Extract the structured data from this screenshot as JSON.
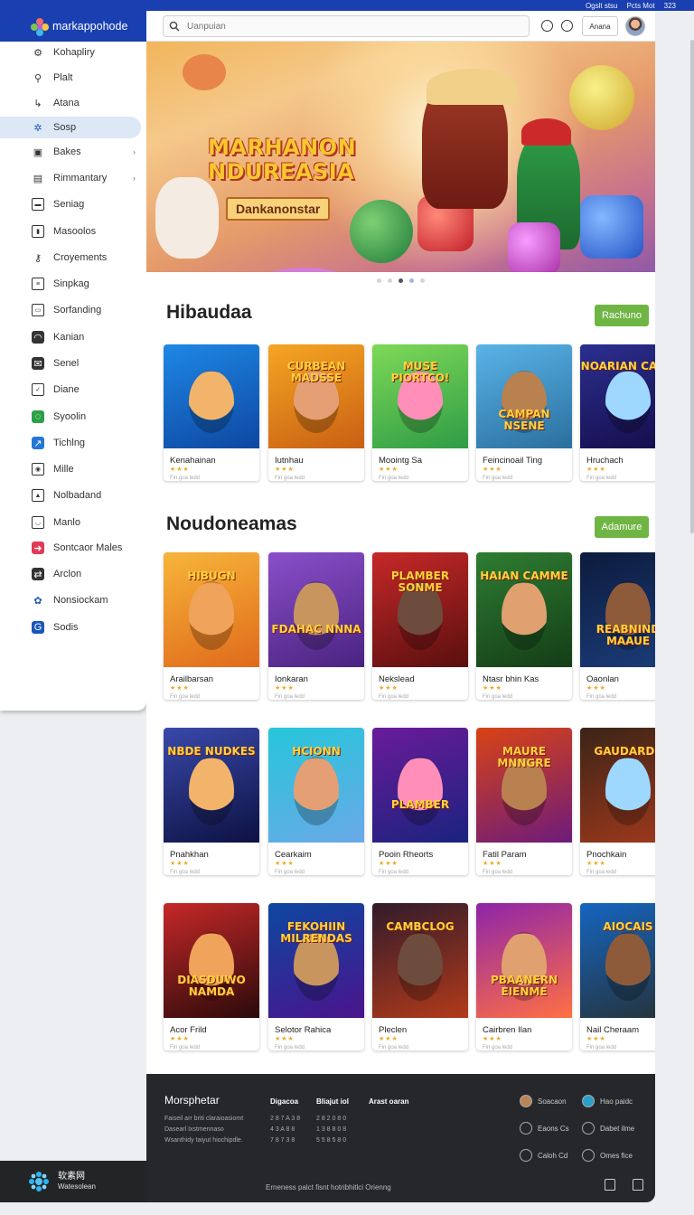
{
  "status": [
    "Ogslt stsu",
    "Pcts Mot",
    "323"
  ],
  "brand": {
    "name": "markappohode"
  },
  "sidebar": {
    "items": [
      {
        "label": "Kohapliry",
        "icon": "robot-icon"
      },
      {
        "label": "Plalt",
        "icon": "pin-icon"
      },
      {
        "label": "Atana",
        "icon": "arrow-icon"
      },
      {
        "label": "Sosp",
        "icon": "star-icon"
      },
      {
        "label": "Bakes",
        "icon": "bag-icon"
      },
      {
        "label": "Rimmantary",
        "icon": "calendar-icon"
      },
      {
        "label": "Seniag",
        "icon": "card-icon"
      },
      {
        "label": "Masoolos",
        "icon": "bookmark-icon"
      },
      {
        "label": "Croyements",
        "icon": "key-icon"
      },
      {
        "label": "Sinpkag",
        "icon": "list-icon"
      },
      {
        "label": "Sorfanding",
        "icon": "window-icon"
      },
      {
        "label": "Kanian",
        "icon": "gamepad-icon"
      },
      {
        "label": "Senel",
        "icon": "mail-icon"
      },
      {
        "label": "Diane",
        "icon": "check-icon"
      },
      {
        "label": "Syoolin",
        "icon": "chat-icon"
      },
      {
        "label": "Tichlng",
        "icon": "ticket-icon"
      },
      {
        "label": "Mille",
        "icon": "camera-icon"
      },
      {
        "label": "Nolbadand",
        "icon": "image-icon"
      },
      {
        "label": "Manlo",
        "icon": "controller-icon"
      },
      {
        "label": "Sontcaor Males",
        "icon": "flag-icon"
      },
      {
        "label": "Arclon",
        "icon": "cart-icon"
      },
      {
        "label": "Nonsiockam",
        "icon": "gear-icon"
      },
      {
        "label": "Sodis",
        "icon": "google-icon"
      }
    ]
  },
  "left_footer": {
    "title": "软素网",
    "subtitle": "Watesolean"
  },
  "topbar": {
    "search_placeholder": "Uanpuian",
    "button": "Anana"
  },
  "hero": {
    "title_line1": "MARHANON",
    "title_line2": "NDUREASIA",
    "subtitle": "Dankanonstar"
  },
  "sections": [
    {
      "title": "Hibaudaa",
      "button": "Rachuno",
      "games": [
        {
          "name": "Kenahainan",
          "caption": ""
        },
        {
          "name": "Iutnhau",
          "caption": "CURBEAN MADSSE"
        },
        {
          "name": "Moointg Sa",
          "caption": "MUSE PIORTCO!"
        },
        {
          "name": "Feincinoail Ting",
          "caption": "CAMPAN NSENE"
        },
        {
          "name": "Hruchach",
          "caption": "NOARIAN CAME"
        }
      ]
    },
    {
      "title": "Noudoneamas",
      "button": "Adamure",
      "games": [
        {
          "name": "Arailbarsan",
          "caption": "HIBUGN"
        },
        {
          "name": "Ionkaran",
          "caption": "FDAHAC NNNA"
        },
        {
          "name": "Nekslead",
          "caption": "PLAMBER SONME"
        },
        {
          "name": "Ntasr bhin Kas",
          "caption": "HAIAN CAMME"
        },
        {
          "name": "Oaonlan",
          "caption": "REABNIND MAAUE"
        },
        {
          "name": "Pnahkhan",
          "caption": "NBDE NUDKES"
        },
        {
          "name": "Cearkaim",
          "caption": "HCIONN"
        },
        {
          "name": "Pooin Rheorts",
          "caption": "PLAMBER"
        },
        {
          "name": "Fatil Param",
          "caption": "MAURE MNNGRE"
        },
        {
          "name": "Pnochkain",
          "caption": "GAUDARDE"
        },
        {
          "name": "Acor Frild",
          "caption": "DIASDUWO NAMDA"
        },
        {
          "name": "Selotor Rahica",
          "caption": "FEKOHIIN MILRENDAS"
        },
        {
          "name": "Pleclen",
          "caption": "CAMBCLOG"
        },
        {
          "name": "Cairbren Ilan",
          "caption": "PBAANERN EIENME"
        },
        {
          "name": "Nail Cheraam",
          "caption": "AIOCAIS"
        }
      ]
    }
  ],
  "card_meta": {
    "stars": "★★★",
    "sub": "Fin goa ledd"
  },
  "footer": {
    "brand": "Morsphetar",
    "headings": [
      "Digacoa",
      "Bliajut iol",
      "Arast oaran"
    ],
    "lines": [
      "Faiseil arr briti claraioasiomt",
      "Dasearl Ixstmennaso",
      "Wsanthidy taiyut hiochipdle."
    ],
    "col2": [
      "2 8 7 A 3 8",
      "4 3 A 8 8",
      "7 8 7 3 8"
    ],
    "col3": [
      "2 8 2 0 8 0",
      "1 3 8 8 0 8",
      "5 5 8 5 8 0"
    ],
    "social": [
      "Soacaon",
      "Hao paidc",
      "Eaons Cs",
      "Dabet ilme",
      "Caloh Cd",
      "Omes fice"
    ],
    "bottom": "Erneness palct fisnt hotribhitlci Orienng"
  },
  "colors": {
    "brand_blue": "#1a3fb0",
    "accent_green": "#6fb544",
    "footer_dark": "#25272a"
  }
}
